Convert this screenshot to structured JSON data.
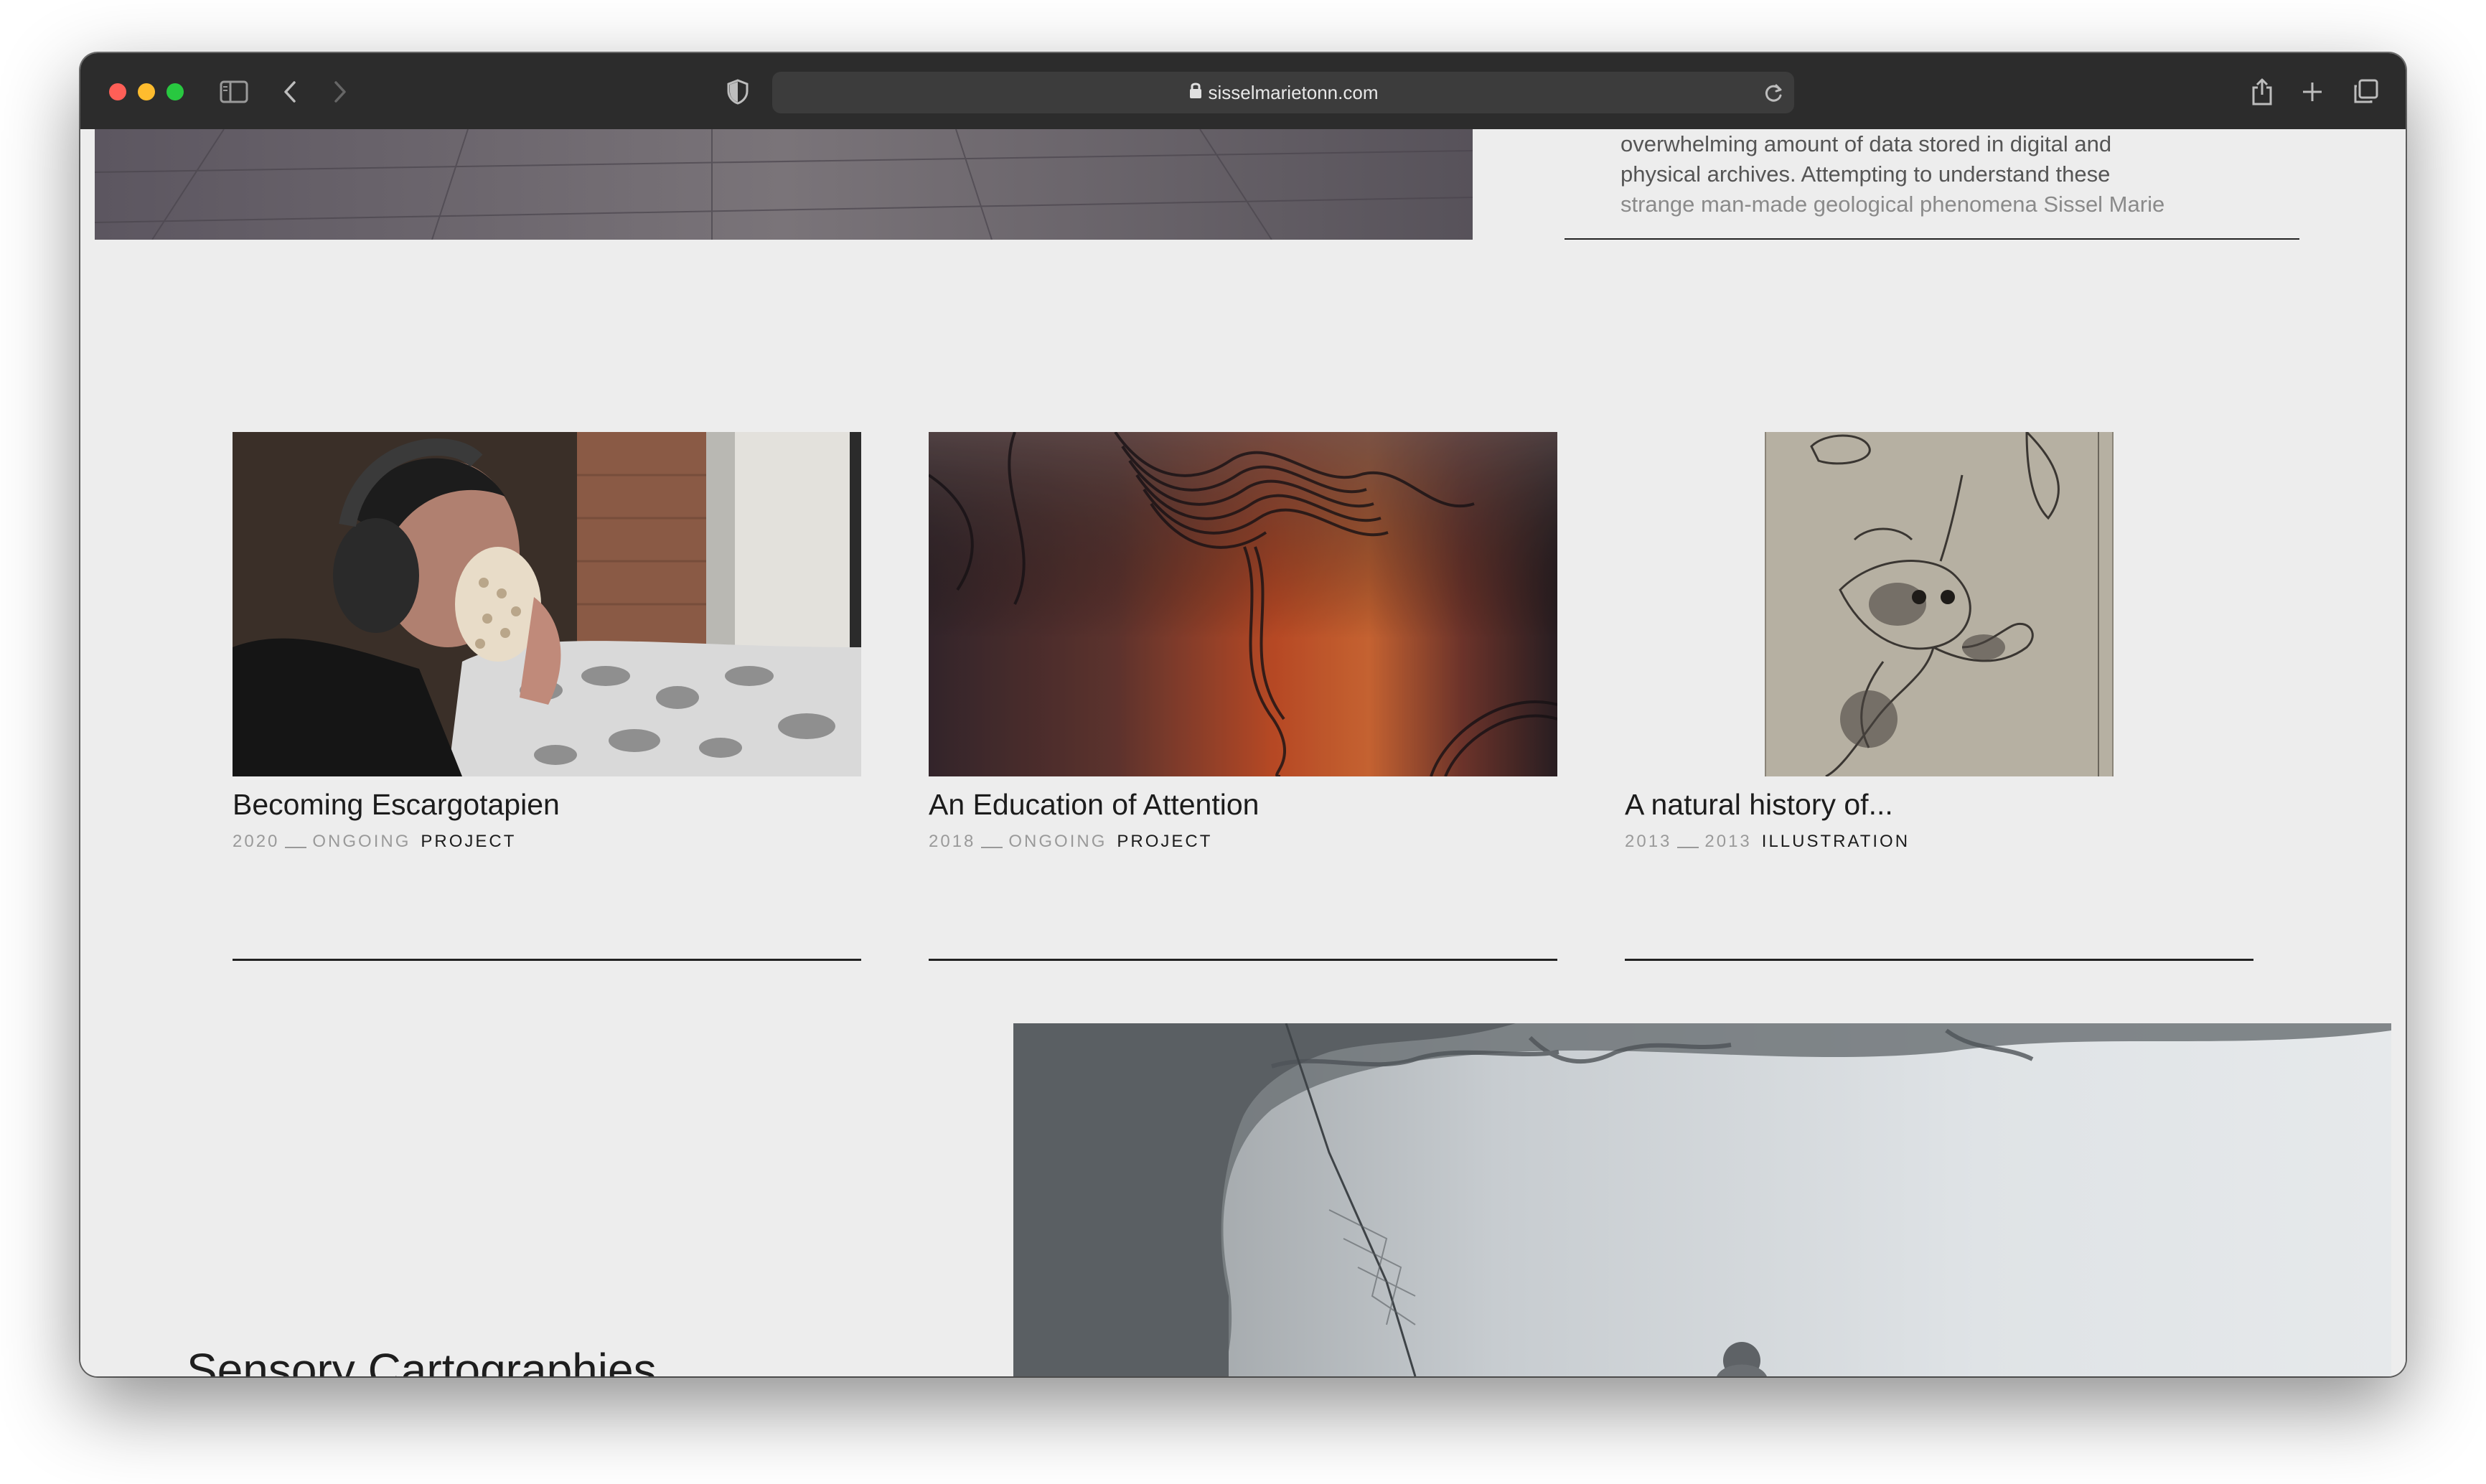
{
  "browser": {
    "url": "sisselmarietonn.com",
    "traffic_lights": {
      "close": "#ff5f57",
      "minimize": "#febc2e",
      "zoom": "#28c840"
    },
    "icons": {
      "sidebar": "sidebar-icon",
      "back": "chevron-left-icon",
      "forward": "chevron-right-icon",
      "privacy": "shield-icon",
      "lock": "lock-icon",
      "reload": "reload-icon",
      "share": "share-icon",
      "new_tab": "plus-icon",
      "tabs": "tabs-overview-icon"
    }
  },
  "hero": {
    "text_lines": [
      "overwhelming amount of data stored in digital and",
      "physical archives. Attempting to understand these",
      "strange man-made geological phenomena Sissel Marie"
    ]
  },
  "projects": [
    {
      "title": "Becoming Escargotapien",
      "year_start": "2020",
      "year_end": "ONGOING",
      "type": "PROJECT"
    },
    {
      "title": "An Education of Attention",
      "year_start": "2018",
      "year_end": "ONGOING",
      "type": "PROJECT"
    },
    {
      "title": "A natural history of...",
      "year_start": "2013",
      "year_end": "2013",
      "type": "ILLUSTRATION"
    }
  ],
  "next_section": {
    "title": "Sensory Cartographies"
  }
}
